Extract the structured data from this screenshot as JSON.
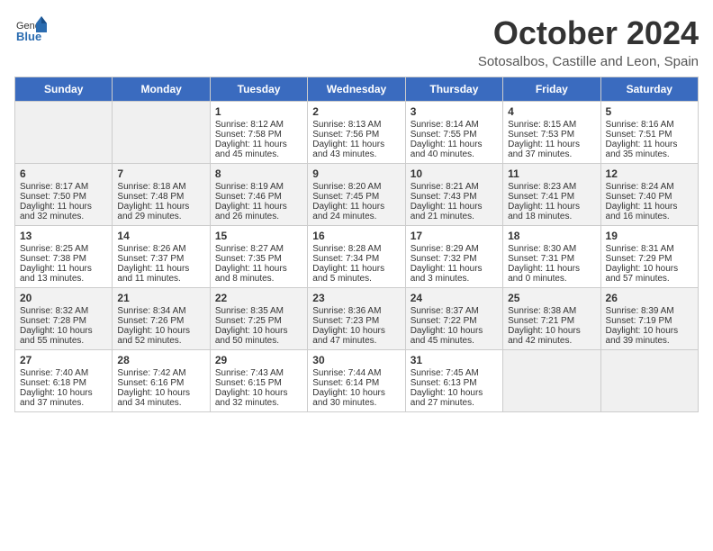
{
  "header": {
    "logo_general": "General",
    "logo_blue": "Blue",
    "title": "October 2024",
    "location": "Sotosalbos, Castille and Leon, Spain"
  },
  "days_of_week": [
    "Sunday",
    "Monday",
    "Tuesday",
    "Wednesday",
    "Thursday",
    "Friday",
    "Saturday"
  ],
  "weeks": [
    [
      {
        "day": "",
        "empty": true
      },
      {
        "day": "",
        "empty": true
      },
      {
        "day": "1",
        "sunrise": "Sunrise: 8:12 AM",
        "sunset": "Sunset: 7:58 PM",
        "daylight": "Daylight: 11 hours and 45 minutes."
      },
      {
        "day": "2",
        "sunrise": "Sunrise: 8:13 AM",
        "sunset": "Sunset: 7:56 PM",
        "daylight": "Daylight: 11 hours and 43 minutes."
      },
      {
        "day": "3",
        "sunrise": "Sunrise: 8:14 AM",
        "sunset": "Sunset: 7:55 PM",
        "daylight": "Daylight: 11 hours and 40 minutes."
      },
      {
        "day": "4",
        "sunrise": "Sunrise: 8:15 AM",
        "sunset": "Sunset: 7:53 PM",
        "daylight": "Daylight: 11 hours and 37 minutes."
      },
      {
        "day": "5",
        "sunrise": "Sunrise: 8:16 AM",
        "sunset": "Sunset: 7:51 PM",
        "daylight": "Daylight: 11 hours and 35 minutes."
      }
    ],
    [
      {
        "day": "6",
        "sunrise": "Sunrise: 8:17 AM",
        "sunset": "Sunset: 7:50 PM",
        "daylight": "Daylight: 11 hours and 32 minutes."
      },
      {
        "day": "7",
        "sunrise": "Sunrise: 8:18 AM",
        "sunset": "Sunset: 7:48 PM",
        "daylight": "Daylight: 11 hours and 29 minutes."
      },
      {
        "day": "8",
        "sunrise": "Sunrise: 8:19 AM",
        "sunset": "Sunset: 7:46 PM",
        "daylight": "Daylight: 11 hours and 26 minutes."
      },
      {
        "day": "9",
        "sunrise": "Sunrise: 8:20 AM",
        "sunset": "Sunset: 7:45 PM",
        "daylight": "Daylight: 11 hours and 24 minutes."
      },
      {
        "day": "10",
        "sunrise": "Sunrise: 8:21 AM",
        "sunset": "Sunset: 7:43 PM",
        "daylight": "Daylight: 11 hours and 21 minutes."
      },
      {
        "day": "11",
        "sunrise": "Sunrise: 8:23 AM",
        "sunset": "Sunset: 7:41 PM",
        "daylight": "Daylight: 11 hours and 18 minutes."
      },
      {
        "day": "12",
        "sunrise": "Sunrise: 8:24 AM",
        "sunset": "Sunset: 7:40 PM",
        "daylight": "Daylight: 11 hours and 16 minutes."
      }
    ],
    [
      {
        "day": "13",
        "sunrise": "Sunrise: 8:25 AM",
        "sunset": "Sunset: 7:38 PM",
        "daylight": "Daylight: 11 hours and 13 minutes."
      },
      {
        "day": "14",
        "sunrise": "Sunrise: 8:26 AM",
        "sunset": "Sunset: 7:37 PM",
        "daylight": "Daylight: 11 hours and 11 minutes."
      },
      {
        "day": "15",
        "sunrise": "Sunrise: 8:27 AM",
        "sunset": "Sunset: 7:35 PM",
        "daylight": "Daylight: 11 hours and 8 minutes."
      },
      {
        "day": "16",
        "sunrise": "Sunrise: 8:28 AM",
        "sunset": "Sunset: 7:34 PM",
        "daylight": "Daylight: 11 hours and 5 minutes."
      },
      {
        "day": "17",
        "sunrise": "Sunrise: 8:29 AM",
        "sunset": "Sunset: 7:32 PM",
        "daylight": "Daylight: 11 hours and 3 minutes."
      },
      {
        "day": "18",
        "sunrise": "Sunrise: 8:30 AM",
        "sunset": "Sunset: 7:31 PM",
        "daylight": "Daylight: 11 hours and 0 minutes."
      },
      {
        "day": "19",
        "sunrise": "Sunrise: 8:31 AM",
        "sunset": "Sunset: 7:29 PM",
        "daylight": "Daylight: 10 hours and 57 minutes."
      }
    ],
    [
      {
        "day": "20",
        "sunrise": "Sunrise: 8:32 AM",
        "sunset": "Sunset: 7:28 PM",
        "daylight": "Daylight: 10 hours and 55 minutes."
      },
      {
        "day": "21",
        "sunrise": "Sunrise: 8:34 AM",
        "sunset": "Sunset: 7:26 PM",
        "daylight": "Daylight: 10 hours and 52 minutes."
      },
      {
        "day": "22",
        "sunrise": "Sunrise: 8:35 AM",
        "sunset": "Sunset: 7:25 PM",
        "daylight": "Daylight: 10 hours and 50 minutes."
      },
      {
        "day": "23",
        "sunrise": "Sunrise: 8:36 AM",
        "sunset": "Sunset: 7:23 PM",
        "daylight": "Daylight: 10 hours and 47 minutes."
      },
      {
        "day": "24",
        "sunrise": "Sunrise: 8:37 AM",
        "sunset": "Sunset: 7:22 PM",
        "daylight": "Daylight: 10 hours and 45 minutes."
      },
      {
        "day": "25",
        "sunrise": "Sunrise: 8:38 AM",
        "sunset": "Sunset: 7:21 PM",
        "daylight": "Daylight: 10 hours and 42 minutes."
      },
      {
        "day": "26",
        "sunrise": "Sunrise: 8:39 AM",
        "sunset": "Sunset: 7:19 PM",
        "daylight": "Daylight: 10 hours and 39 minutes."
      }
    ],
    [
      {
        "day": "27",
        "sunrise": "Sunrise: 7:40 AM",
        "sunset": "Sunset: 6:18 PM",
        "daylight": "Daylight: 10 hours and 37 minutes."
      },
      {
        "day": "28",
        "sunrise": "Sunrise: 7:42 AM",
        "sunset": "Sunset: 6:16 PM",
        "daylight": "Daylight: 10 hours and 34 minutes."
      },
      {
        "day": "29",
        "sunrise": "Sunrise: 7:43 AM",
        "sunset": "Sunset: 6:15 PM",
        "daylight": "Daylight: 10 hours and 32 minutes."
      },
      {
        "day": "30",
        "sunrise": "Sunrise: 7:44 AM",
        "sunset": "Sunset: 6:14 PM",
        "daylight": "Daylight: 10 hours and 30 minutes."
      },
      {
        "day": "31",
        "sunrise": "Sunrise: 7:45 AM",
        "sunset": "Sunset: 6:13 PM",
        "daylight": "Daylight: 10 hours and 27 minutes."
      },
      {
        "day": "",
        "empty": true
      },
      {
        "day": "",
        "empty": true
      }
    ]
  ]
}
